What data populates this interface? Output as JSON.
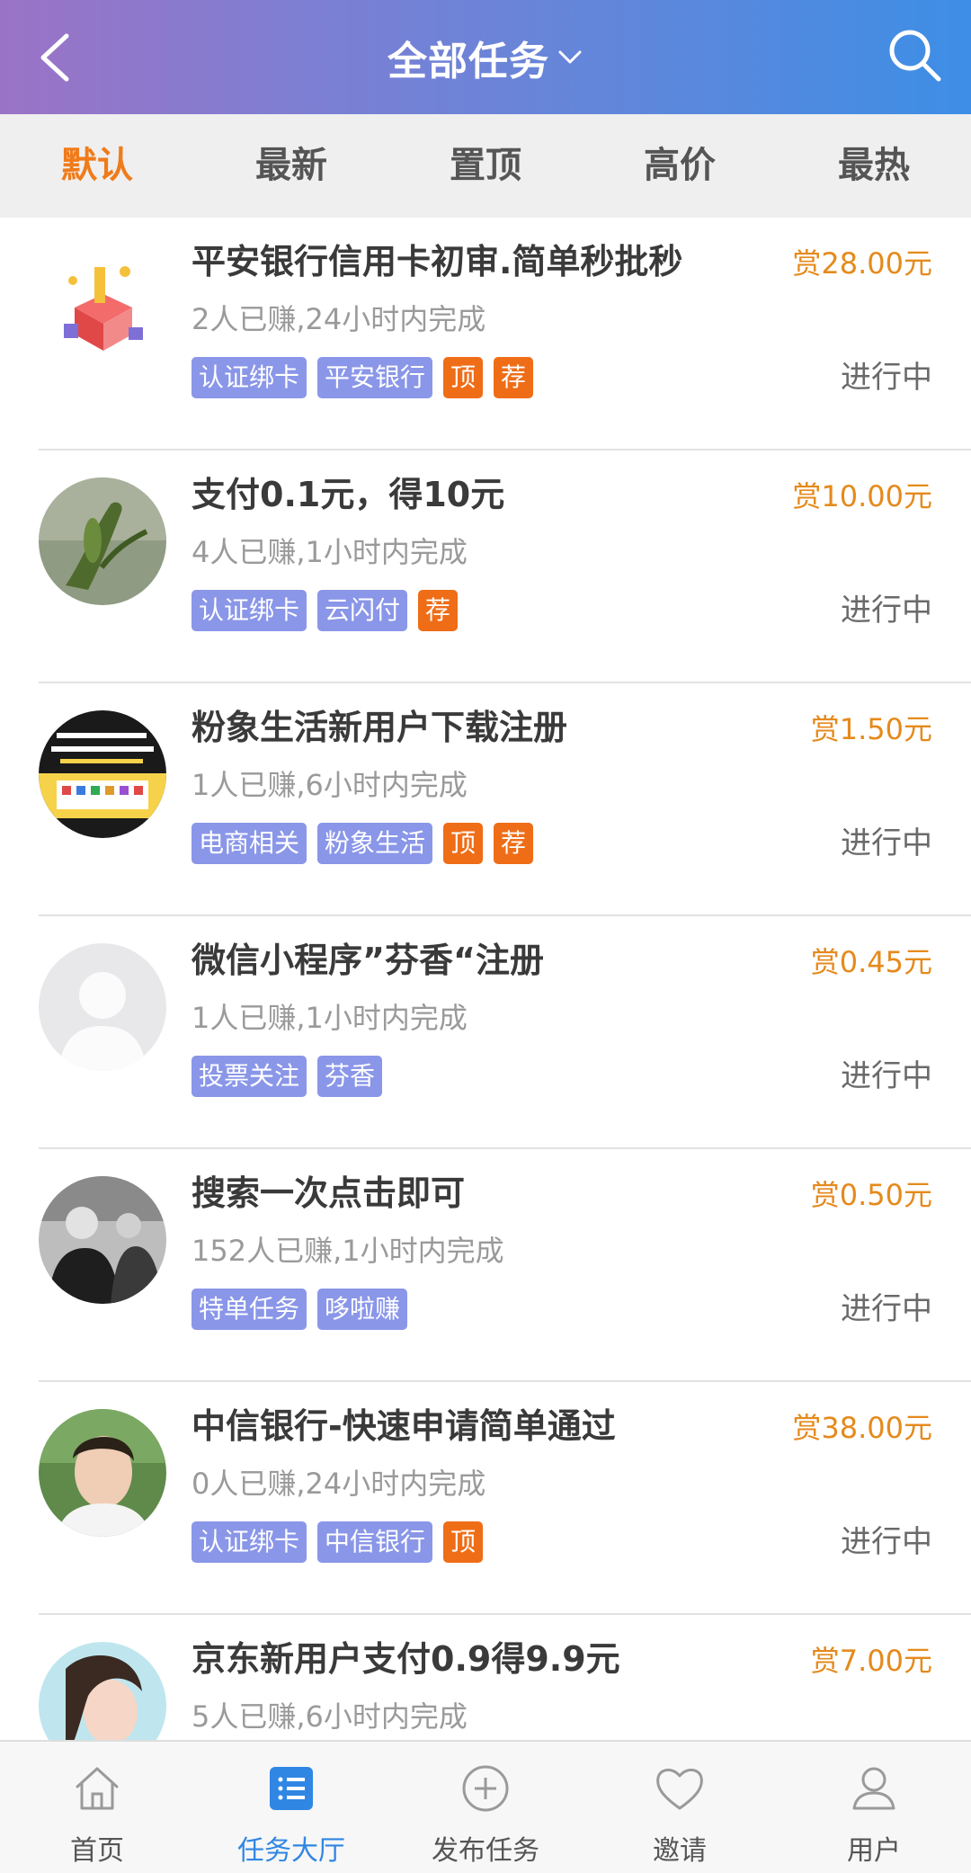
{
  "header": {
    "title": "全部任务",
    "back_icon": "back-arrow-icon",
    "dropdown_icon": "chevron-down-icon",
    "search_icon": "search-icon"
  },
  "tabs": [
    {
      "label": "默认",
      "active": true
    },
    {
      "label": "最新",
      "active": false
    },
    {
      "label": "置顶",
      "active": false
    },
    {
      "label": "高价",
      "active": false
    },
    {
      "label": "最热",
      "active": false
    }
  ],
  "tasks": [
    {
      "title": "平安银行信用卡初审.简单秒批秒",
      "meta": "2人已赚,24小时内完成",
      "reward": "赏28.00元",
      "status": "进行中",
      "tags": [
        {
          "label": "认证绑卡"
        },
        {
          "label": "平安银行"
        },
        {
          "label": "顶",
          "type": "orange"
        },
        {
          "label": "荐",
          "type": "orange"
        }
      ]
    },
    {
      "title": "支付0.1元，得10元",
      "meta": "4人已赚,1小时内完成",
      "reward": "赏10.00元",
      "status": "进行中",
      "tags": [
        {
          "label": "认证绑卡"
        },
        {
          "label": "云闪付"
        },
        {
          "label": "荐",
          "type": "orange"
        }
      ]
    },
    {
      "title": "粉象生活新用户下载注册",
      "meta": "1人已赚,6小时内完成",
      "reward": "赏1.50元",
      "status": "进行中",
      "tags": [
        {
          "label": "电商相关"
        },
        {
          "label": "粉象生活"
        },
        {
          "label": "顶",
          "type": "orange"
        },
        {
          "label": "荐",
          "type": "orange"
        }
      ]
    },
    {
      "title": "微信小程序”芬香“注册",
      "meta": "1人已赚,1小时内完成",
      "reward": "赏0.45元",
      "status": "进行中",
      "tags": [
        {
          "label": "投票关注"
        },
        {
          "label": "芬香"
        }
      ]
    },
    {
      "title": "搜索一次点击即可",
      "meta": "152人已赚,1小时内完成",
      "reward": "赏0.50元",
      "status": "进行中",
      "tags": [
        {
          "label": "特单任务"
        },
        {
          "label": "哆啦赚"
        }
      ]
    },
    {
      "title": "中信银行-快速申请简单通过",
      "meta": "0人已赚,24小时内完成",
      "reward": "赏38.00元",
      "status": "进行中",
      "tags": [
        {
          "label": "认证绑卡"
        },
        {
          "label": "中信银行"
        },
        {
          "label": "顶",
          "type": "orange"
        }
      ]
    },
    {
      "title": "京东新用户支付0.9得9.9元",
      "meta": "5人已赚,6小时内完成",
      "reward": "赏7.00元",
      "status": "",
      "tags": []
    }
  ],
  "bottom_nav": [
    {
      "label": "首页",
      "icon": "home-icon",
      "active": false
    },
    {
      "label": "任务大厅",
      "icon": "task-list-icon",
      "active": true
    },
    {
      "label": "发布任务",
      "icon": "plus-circle-icon",
      "active": false
    },
    {
      "label": "邀请",
      "icon": "heart-icon",
      "active": false
    },
    {
      "label": "用户",
      "icon": "user-icon",
      "active": false
    }
  ],
  "colors": {
    "accent": "#f07b1a",
    "reward": "#e58a1c",
    "tag": "#8a96e8",
    "tag_orange": "#ef6d17",
    "nav_active": "#2f86e3"
  }
}
